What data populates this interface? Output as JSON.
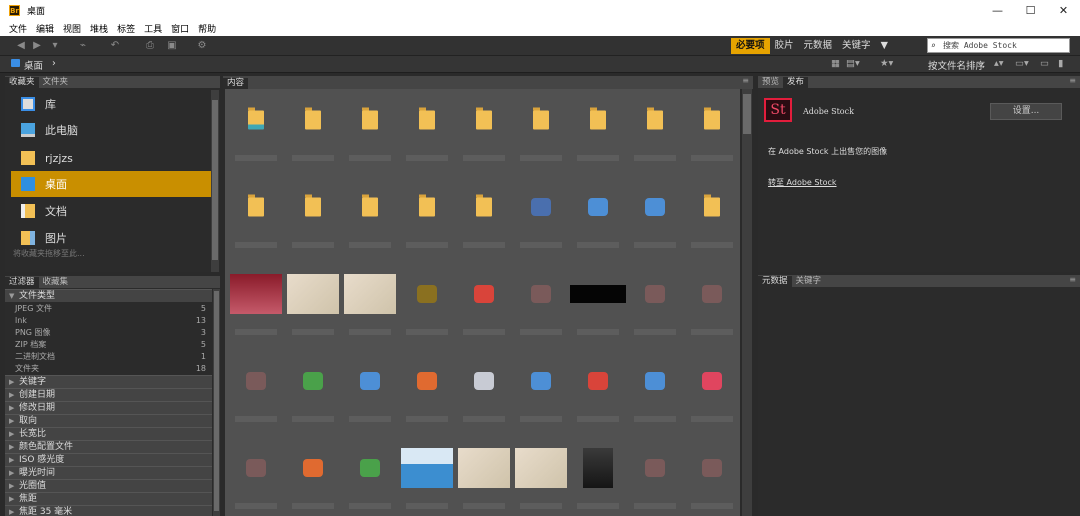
{
  "window": {
    "title": "桌面",
    "app_badge": "Br",
    "minimize": "—",
    "maximize": "☐",
    "close": "✕"
  },
  "menu": [
    "文件",
    "编辑",
    "视图",
    "堆栈",
    "标签",
    "工具",
    "窗口",
    "帮助"
  ],
  "toolbar": {
    "workspaces": [
      "必要项",
      "胶片",
      "元数据",
      "关键字"
    ],
    "active_workspace": "必要项",
    "workspace_menu": "▼",
    "search_placeholder": "搜索 Adobe Stock"
  },
  "path": {
    "crumb": "桌面",
    "sep": "›",
    "sort_label": "按文件名排序"
  },
  "left_top": {
    "tabs": [
      "收藏夹",
      "文件夹"
    ],
    "items": [
      {
        "label": "库",
        "icon": "library-icon"
      },
      {
        "label": "此电脑",
        "icon": "computer-icon"
      },
      {
        "label": "rjzjzs",
        "icon": "folder-icon"
      },
      {
        "label": "桌面",
        "icon": "desktop-icon",
        "selected": true
      },
      {
        "label": "文档",
        "icon": "documents-icon"
      },
      {
        "label": "图片",
        "icon": "pictures-icon"
      }
    ],
    "drop_hint": "将收藏夹拖移至此..."
  },
  "filter": {
    "tabs": [
      "过滤器",
      "收藏集"
    ],
    "file_type": {
      "title": "文件类型",
      "rows": [
        {
          "label": "JPEG 文件",
          "count": "5"
        },
        {
          "label": "lnk",
          "count": "13"
        },
        {
          "label": "PNG 图像",
          "count": "3"
        },
        {
          "label": "ZIP 档案",
          "count": "5"
        },
        {
          "label": "二进制文档",
          "count": "1"
        },
        {
          "label": "文件夹",
          "count": "18"
        }
      ]
    },
    "categories": [
      "关键字",
      "创建日期",
      "修改日期",
      "取向",
      "长宽比",
      "颜色配置文件",
      "ISO 感光度",
      "曝光时间",
      "光圈值",
      "焦距",
      "焦距 35 毫米"
    ]
  },
  "content": {
    "tab": "内容"
  },
  "preview": {
    "tabs": [
      "预览",
      "发布"
    ],
    "stock_name": "Adobe Stock",
    "settings_btn": "设置...",
    "sell_text": "在 Adobe Stock 上出售您的图像",
    "goto_link": "转至 Adobe Stock"
  },
  "metadata": {
    "tabs": [
      "元数据",
      "关键字"
    ]
  },
  "colors": {
    "accent": "#e6a300",
    "selected": "#c98f00",
    "panel": "#2b2b2b",
    "content_bg": "#515151",
    "stock_red": "#e31d3c"
  }
}
